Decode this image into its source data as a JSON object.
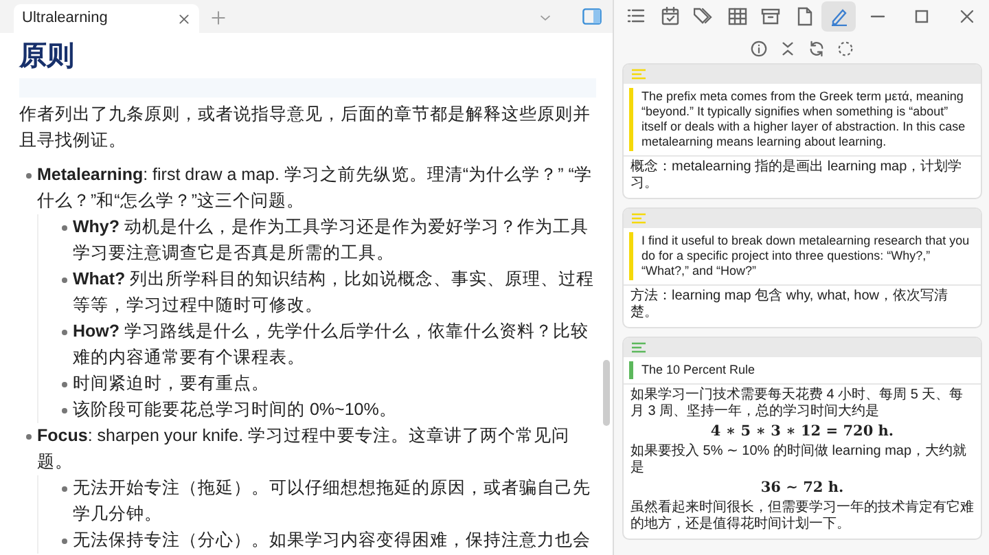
{
  "tabs": [
    {
      "label": "Ultralearning",
      "selected": true
    }
  ],
  "document": {
    "heading": "原则",
    "intro": "作者列出了九条原则，或者说指导意见，后面的章节都是解释这些原则并且寻找例证。",
    "items": [
      {
        "text": "**Metalearning**: first draw a map. 学习之前先纵览。理清“为什么学？” “学什么？”和“怎么学？”这三个问题。",
        "children": [
          {
            "text": "**Why?** 动机是什么，是作为工具学习还是作为爱好学习？作为工具学习要注意调查它是否真是所需的工具。"
          },
          {
            "text": "**What?** 列出所学科目的知识结构，比如说概念、事实、原理、过程等等，学习过程中随时可修改。"
          },
          {
            "text": "**How?** 学习路线是什么，先学什么后学什么，依靠什么资料？比较难的内容通常要有个课程表。"
          },
          {
            "text": "时间紧迫时，要有重点。"
          },
          {
            "text": "该阶段可能要花总学习时间的 0%~10%。"
          }
        ]
      },
      {
        "text": "**Focus**: sharpen your knife. 学习过程中要专注。这章讲了两个常见问题。",
        "children": [
          {
            "text": "无法开始专注（拖延）。可以仔细想想拖延的原因，或者骗自己先学几分钟。"
          },
          {
            "text": "无法保持专注（分心）。如果学习内容变得困难，保持注意力也会"
          }
        ]
      }
    ]
  },
  "annotations": [
    {
      "color": "#f5d90a",
      "quote": "The prefix meta comes from the Greek term μετά, meaning “beyond.” It typically signifies when something is “about” itself or deals with a higher layer of abstraction. In this case metalearning means learning about learning.",
      "note": [
        {
          "kind": "text",
          "text": "概念：metalearning 指的是画出 learning map，计划学习。"
        }
      ]
    },
    {
      "color": "#f5d90a",
      "quote": "I find it useful to break down metalearning research that you do for a specific project into three questions: “Why?,” “What?,” and “How?”",
      "note": [
        {
          "kind": "text",
          "text": "方法：learning map 包含 why, what, how，依次写清楚。"
        }
      ]
    },
    {
      "color": "#5cb85c",
      "quote": "The 10 Percent Rule",
      "note": [
        {
          "kind": "text",
          "text": "如果学习一门技术需要每天花费 4 小时、每周 5 天、每月 3 周、坚持一年，总的学习时间大约是"
        },
        {
          "kind": "math",
          "text": "4 ∗ 5 ∗ 3 ∗ 12 = 720 h."
        },
        {
          "kind": "text",
          "text": "如果要投入 5% ∼ 10% 的时间做 learning map，大约就是"
        },
        {
          "kind": "math",
          "text": "36 ∼ 72 h."
        },
        {
          "kind": "text",
          "text": "虽然看起来时间很长，但需要学习一年的技术肯定有它难的地方，还是值得花时间计划一下。"
        }
      ]
    }
  ]
}
